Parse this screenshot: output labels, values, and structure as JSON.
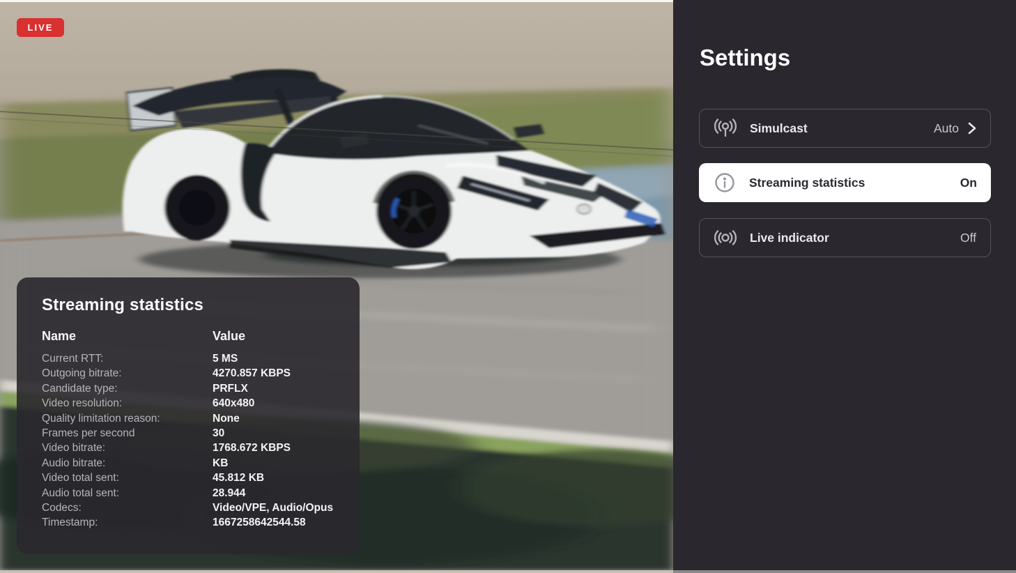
{
  "live_badge": {
    "label": "LIVE"
  },
  "settings": {
    "title": "Settings",
    "items": [
      {
        "icon": "broadcast-icon",
        "label": "Simulcast",
        "value": "Auto",
        "has_chevron": true,
        "selected": false
      },
      {
        "icon": "info-icon",
        "label": "Streaming statistics",
        "value": "On",
        "has_chevron": false,
        "selected": true
      },
      {
        "icon": "live-indicator-icon",
        "label": "Live indicator",
        "value": "Off",
        "has_chevron": false,
        "selected": false
      }
    ]
  },
  "stats_panel": {
    "title": "Streaming statistics",
    "columns": [
      "Name",
      "Value"
    ],
    "rows": [
      {
        "name": "Current RTT:",
        "value": "5 MS"
      },
      {
        "name": "Outgoing bitrate:",
        "value": "4270.857 KBPS"
      },
      {
        "name": "Candidate type:",
        "value": "PRFLX"
      },
      {
        "name": "Video resolution:",
        "value": "640x480"
      },
      {
        "name": "Quality limitation reason:",
        "value": "None"
      },
      {
        "name": "Frames per second",
        "value": "30"
      },
      {
        "name": "Video bitrate:",
        "value": "1768.672 KBPS"
      },
      {
        "name": "Audio bitrate:",
        "value": "KB"
      },
      {
        "name": "Video total sent:",
        "value": "45.812 KB"
      },
      {
        "name": "Audio total sent:",
        "value": "28.944"
      },
      {
        "name": "Codecs:",
        "value": "Video/VPE, Audio/Opus"
      },
      {
        "name": "Timestamp:",
        "value": "1667258642544.58"
      }
    ]
  },
  "colors": {
    "live_red": "#d93030",
    "settings_bg": "#2a272e",
    "row_border": "#56535b",
    "row_selected_bg": "#ffffff",
    "overlay_bg": "rgba(42,40,46,0.90)"
  }
}
